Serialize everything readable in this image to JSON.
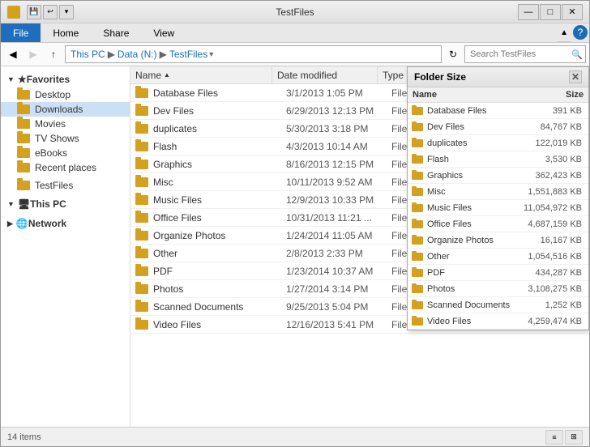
{
  "window": {
    "title": "TestFiles",
    "icon": "folder-icon"
  },
  "ribbon": {
    "tabs": [
      "File",
      "Home",
      "Share",
      "View"
    ],
    "active_tab": "File"
  },
  "address": {
    "path": [
      "This PC",
      "Data (N:)",
      "TestFiles"
    ],
    "search_placeholder": "Search TestFiles"
  },
  "nav": {
    "back_disabled": false,
    "forward_disabled": true
  },
  "sidebar": {
    "favorites_label": "Favorites",
    "items_favorites": [
      {
        "label": "Desktop",
        "icon": "folder"
      },
      {
        "label": "Downloads",
        "icon": "folder"
      },
      {
        "label": "Movies",
        "icon": "folder"
      },
      {
        "label": "TV Shows",
        "icon": "folder"
      },
      {
        "label": "eBooks",
        "icon": "folder"
      },
      {
        "label": "Recent places",
        "icon": "folder"
      }
    ],
    "this_pc_label": "This PC",
    "network_label": "Network",
    "selected_item": "TestFiles",
    "testfiles_label": "TestFiles"
  },
  "columns": {
    "name": "Name",
    "date": "Date modified",
    "type": "Type",
    "size": "Size"
  },
  "files": [
    {
      "name": "Database Files",
      "date": "3/1/2013 1:05 PM",
      "type": "File fol...",
      "size": ""
    },
    {
      "name": "Dev Files",
      "date": "6/29/2013 12:13 PM",
      "type": "File fol...",
      "size": ""
    },
    {
      "name": "duplicates",
      "date": "5/30/2013 3:18 PM",
      "type": "File fol...",
      "size": ""
    },
    {
      "name": "Flash",
      "date": "4/3/2013 10:14 AM",
      "type": "File fol...",
      "size": ""
    },
    {
      "name": "Graphics",
      "date": "8/16/2013 12:15 PM",
      "type": "File fol...",
      "size": ""
    },
    {
      "name": "Misc",
      "date": "10/11/2013 9:52 AM",
      "type": "File fol...",
      "size": ""
    },
    {
      "name": "Music Files",
      "date": "12/9/2013 10:33 PM",
      "type": "File fol...",
      "size": ""
    },
    {
      "name": "Office Files",
      "date": "10/31/2013 11:21 ...",
      "type": "File fol...",
      "size": ""
    },
    {
      "name": "Organize Photos",
      "date": "1/24/2014 11:05 AM",
      "type": "File fol...",
      "size": ""
    },
    {
      "name": "Other",
      "date": "2/8/2013 2:33 PM",
      "type": "File fol...",
      "size": ""
    },
    {
      "name": "PDF",
      "date": "1/23/2014 10:37 AM",
      "type": "File fol...",
      "size": ""
    },
    {
      "name": "Photos",
      "date": "1/27/2014 3:14 PM",
      "type": "File fol...",
      "size": ""
    },
    {
      "name": "Scanned Documents",
      "date": "9/25/2013 5:04 PM",
      "type": "File fol...",
      "size": ""
    },
    {
      "name": "Video Files",
      "date": "12/16/2013 5:41 PM",
      "type": "File fol...",
      "size": ""
    }
  ],
  "status": {
    "item_count": "14 items"
  },
  "folder_size_popup": {
    "title": "Folder Size",
    "col_name": "Name",
    "col_size": "Size",
    "items": [
      {
        "name": "Database Files",
        "size": "391 KB"
      },
      {
        "name": "Dev Files",
        "size": "84,767 KB"
      },
      {
        "name": "duplicates",
        "size": "122,019 KB"
      },
      {
        "name": "Flash",
        "size": "3,530 KB"
      },
      {
        "name": "Graphics",
        "size": "362,423 KB"
      },
      {
        "name": "Misc",
        "size": "1,551,883 KB"
      },
      {
        "name": "Music Files",
        "size": "11,054,972 KB"
      },
      {
        "name": "Office Files",
        "size": "4,687,159 KB"
      },
      {
        "name": "Organize Photos",
        "size": "16,167 KB"
      },
      {
        "name": "Other",
        "size": "1,054,516 KB"
      },
      {
        "name": "PDF",
        "size": "434,287 KB"
      },
      {
        "name": "Photos",
        "size": "3,108,275 KB"
      },
      {
        "name": "Scanned Documents",
        "size": "1,252 KB"
      },
      {
        "name": "Video Files",
        "size": "4,259,474 KB"
      }
    ]
  }
}
